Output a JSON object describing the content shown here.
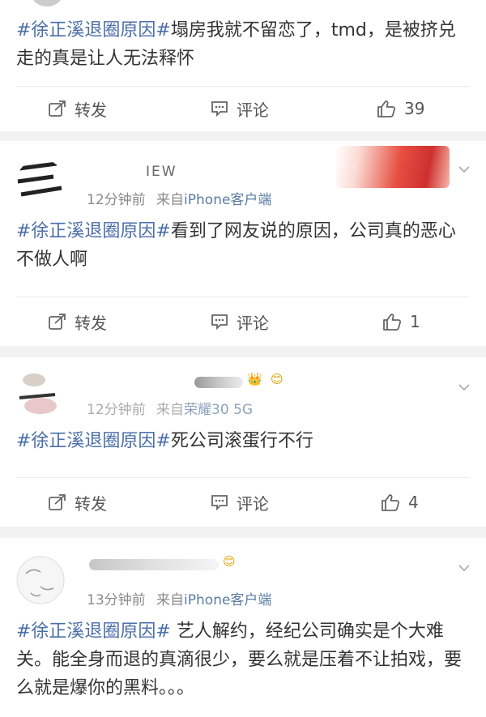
{
  "top_post": {
    "text_tag": "#徐正溪退圈原因#",
    "text_body": "塌房我就不留恋了，tmd，是被挤兑走的真是让人无法释怀",
    "actions": {
      "repost": "转发",
      "comment": "评论",
      "like_count": "39"
    }
  },
  "posts": [
    {
      "name": "IEW",
      "time": "12分钟前",
      "source_prefix": "来自",
      "source": "iPhone客户端",
      "text_tag": "#徐正溪退圈原因#",
      "text_body": "看到了网友说的原因，公司真的恶心不做人啊",
      "actions": {
        "repost": "转发",
        "comment": "评论",
        "like_count": "1"
      }
    },
    {
      "name": "",
      "time": "12分钟前",
      "source_prefix": "来自",
      "source": "荣耀30 5G",
      "text_tag": "#徐正溪退圈原因#",
      "text_body": "死公司滚蛋行不行",
      "actions": {
        "repost": "转发",
        "comment": "评论",
        "like_count": "4"
      }
    },
    {
      "name": "",
      "time": "13分钟前",
      "source_prefix": "来自",
      "source": "iPhone客户端",
      "text_tag": "#徐正溪退圈原因#",
      "text_body": " 艺人解约，经纪公司确实是个大难关。能全身而退的真滴很少，要么就是压着不让拍戏，要么就是爆你的黑料。。。"
    }
  ],
  "colors": {
    "accent": "#4a6ea9",
    "background": "#f2f2f2"
  },
  "icons": [
    "repost-icon",
    "comment-icon",
    "like-icon",
    "chevron-down-icon"
  ]
}
